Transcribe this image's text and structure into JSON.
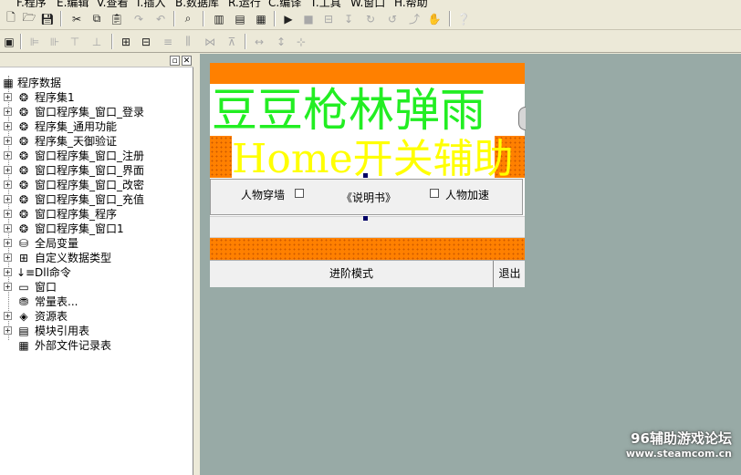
{
  "menu": [
    "F.程序",
    "E.编辑",
    "V.查看",
    "I.插入",
    "B.数据库",
    "R.运行",
    "C.编译",
    "T.工具",
    "W.窗口",
    "H.帮助"
  ],
  "toolbar1": [
    "new-file-icon",
    "open-folder-icon",
    "save-icon",
    "cut-icon",
    "copy-icon",
    "paste-icon",
    "redo-icon",
    "undo-icon",
    "find-icon",
    "layout-a-icon",
    "layout-b-icon",
    "layout-c-icon",
    "run-icon",
    "stop-icon",
    "step-icon",
    "step-into-icon",
    "step-over-icon",
    "step-out-icon",
    "hand-icon",
    "help-icon"
  ],
  "panel": {
    "pin": "▫",
    "close": "✕"
  },
  "tree": {
    "root": "程序数据",
    "items": [
      {
        "label": "程序集1",
        "icon": "program-set-icon",
        "glyph": "❂",
        "expand": "+"
      },
      {
        "label": "窗口程序集_窗口_登录",
        "icon": "program-set-icon",
        "glyph": "❂",
        "expand": "+"
      },
      {
        "label": "程序集_通用功能",
        "icon": "program-set-icon",
        "glyph": "❂",
        "expand": "+"
      },
      {
        "label": "程序集_天御验证",
        "icon": "program-set-icon",
        "glyph": "❂",
        "expand": "+"
      },
      {
        "label": "窗口程序集_窗口_注册",
        "icon": "program-set-icon",
        "glyph": "❂",
        "expand": "+"
      },
      {
        "label": "窗口程序集_窗口_界面",
        "icon": "program-set-icon",
        "glyph": "❂",
        "expand": "+"
      },
      {
        "label": "窗口程序集_窗口_改密",
        "icon": "program-set-icon",
        "glyph": "❂",
        "expand": "+"
      },
      {
        "label": "窗口程序集_窗口_充值",
        "icon": "program-set-icon",
        "glyph": "❂",
        "expand": "+"
      },
      {
        "label": "窗口程序集_程序",
        "icon": "program-set-icon",
        "glyph": "❂",
        "expand": "+"
      },
      {
        "label": "窗口程序集_窗口1",
        "icon": "program-set-icon",
        "glyph": "❂",
        "expand": "+"
      },
      {
        "label": "全局变量",
        "icon": "global-var-icon",
        "glyph": "⛁",
        "expand": "+"
      },
      {
        "label": "自定义数据类型",
        "icon": "custom-type-icon",
        "glyph": "⊞",
        "expand": "+"
      },
      {
        "label": "Dll命令",
        "icon": "dll-command-icon",
        "glyph": "↓≡",
        "expand": "+"
      },
      {
        "label": "窗口",
        "icon": "window-icon",
        "glyph": "▭",
        "expand": "+"
      },
      {
        "label": "常量表...",
        "icon": "constant-table-icon",
        "glyph": "⛃",
        "expand": ""
      },
      {
        "label": "资源表",
        "icon": "resource-table-icon",
        "glyph": "◈",
        "expand": "+"
      },
      {
        "label": "模块引用表",
        "icon": "module-ref-icon",
        "glyph": "▤",
        "expand": "+"
      },
      {
        "label": "外部文件记录表",
        "icon": "external-file-icon",
        "glyph": "▦",
        "expand": ""
      }
    ]
  },
  "form": {
    "title": "豆豆枪林弹雨",
    "subtitle": "Home开关辅助",
    "checkbox1": "人物穿墙",
    "link": "《说明书》",
    "checkbox2": "人物加速",
    "button_main": "进阶模式",
    "button_exit": "退出"
  },
  "colors": {
    "bar": "#ff8000",
    "title": "#22ee22",
    "subtitle": "#ffff00",
    "designer_bg": "#98aaa6"
  },
  "watermark": {
    "line1": "96辅助游戏论坛",
    "line2": "www.steamcom.cn"
  }
}
